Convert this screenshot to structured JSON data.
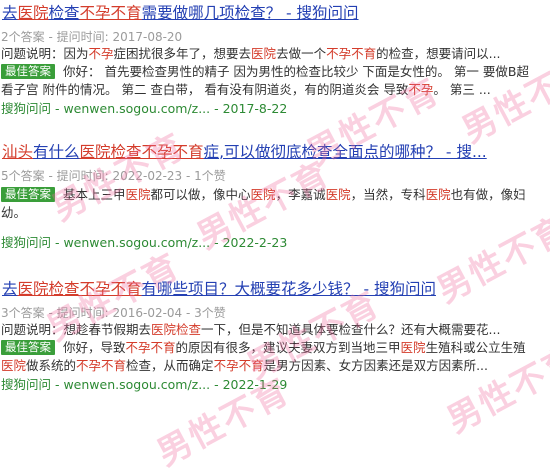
{
  "results": [
    {
      "title": [
        {
          "t": "去",
          "hl": false
        },
        {
          "t": "医院",
          "hl": true
        },
        {
          "t": "检查",
          "hl": false
        },
        {
          "t": "不孕不育",
          "hl": true
        },
        {
          "t": "需要做哪几项检查？ - 搜狗问问",
          "hl": false
        }
      ],
      "meta": "2个答案 - 提问时间: 2017-08-20",
      "desc1": [
        {
          "t": "问题说明：因为",
          "em": false
        },
        {
          "t": "不孕",
          "em": true
        },
        {
          "t": "症困扰很多年了，想要去",
          "em": false
        },
        {
          "t": "医院",
          "em": true
        },
        {
          "t": "去做一个",
          "em": false
        },
        {
          "t": "不孕不育",
          "em": true
        },
        {
          "t": "的检查，想要请问以...",
          "em": false
        }
      ],
      "badge": "最佳答案",
      "desc2": [
        {
          "t": "你好： 首先要检查男性的精子 因为男性的检查比较少 下面是女性的。 第一 要做B超",
          "em": false
        }
      ],
      "desc3": [
        {
          "t": "看子宫 附件的情况。 第二 查白带， 看有没有阴道炎，有的阴道炎会 导致",
          "em": false
        },
        {
          "t": "不孕",
          "em": true
        },
        {
          "t": "。 第三 ...",
          "em": false
        }
      ],
      "source": "搜狗问问 - wenwen.sogou.com/z... - 2017-8-22"
    },
    {
      "title": [
        {
          "t": "汕头",
          "hl": true
        },
        {
          "t": "有什么",
          "hl": false
        },
        {
          "t": "医院检查不孕不育",
          "hl": true
        },
        {
          "t": "症",
          "hl": false
        },
        {
          "t": ",可以做彻底检查全面点的哪种？ - 搜...",
          "hl": false
        }
      ],
      "meta": "5个答案 - 提问时间: 2022-02-23 - 1个赞",
      "badge": "最佳答案",
      "desc2": [
        {
          "t": "基本上三甲",
          "em": false
        },
        {
          "t": "医院",
          "em": true
        },
        {
          "t": "都可以做，像中心",
          "em": false
        },
        {
          "t": "医院",
          "em": true
        },
        {
          "t": "，李嘉诚",
          "em": false
        },
        {
          "t": "医院",
          "em": true
        },
        {
          "t": "，当然，专科",
          "em": false
        },
        {
          "t": "医院",
          "em": true
        },
        {
          "t": "也有做，像妇",
          "em": false
        }
      ],
      "desc3": [
        {
          "t": "幼。",
          "em": false
        }
      ],
      "source": "搜狗问问 - wenwen.sogou.com/z... - 2022-2-23"
    },
    {
      "title": [
        {
          "t": "去",
          "hl": false
        },
        {
          "t": "医院检查不孕不育",
          "hl": true
        },
        {
          "t": "有哪些项目？大概要花多少钱？ - 搜狗问问",
          "hl": false
        }
      ],
      "meta": "3个答案 - 提问时间: 2016-02-04 - 3个赞",
      "desc1": [
        {
          "t": "问题说明：想趁春节假期去",
          "em": false
        },
        {
          "t": "医院检查",
          "em": true
        },
        {
          "t": "一下，但是不知道具体要检查什么？还有大概需要花...",
          "em": false
        }
      ],
      "badge": "最佳答案",
      "desc2": [
        {
          "t": "你好，导致",
          "em": false
        },
        {
          "t": "不孕不育",
          "em": true
        },
        {
          "t": "的原因有很多，建议夫妻双方到当地三甲",
          "em": false
        },
        {
          "t": "医院",
          "em": true
        },
        {
          "t": "生殖科或公立生殖",
          "em": false
        }
      ],
      "desc3": [
        {
          "t": "医院",
          "em": true
        },
        {
          "t": "做系统的",
          "em": false
        },
        {
          "t": "不孕不育",
          "em": true
        },
        {
          "t": "检查，从而确定",
          "em": false
        },
        {
          "t": "不孕不育",
          "em": true
        },
        {
          "t": "是男方因素、女方因素还是双方因素所...",
          "em": false
        }
      ],
      "source": "搜狗问问 - wenwen.sogou.com/z... - 2022-1-29"
    }
  ],
  "watermarks": [
    "男性不育",
    "男性不育",
    "男性不育",
    "男性不育",
    "男性不育",
    "男性不育",
    "男性不育",
    "男性不育",
    "男性不育"
  ]
}
